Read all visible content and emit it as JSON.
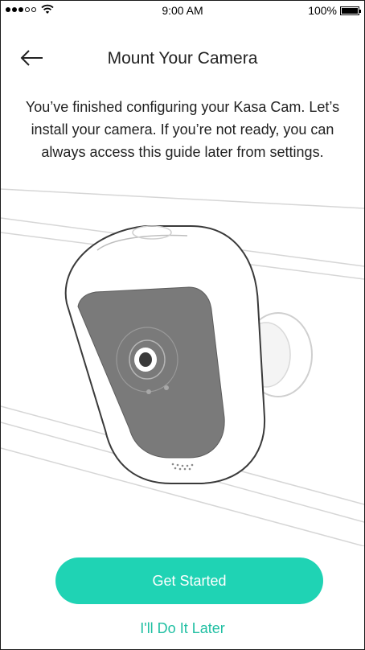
{
  "status_bar": {
    "time": "9:00 AM",
    "battery_text": "100%",
    "battery_level": 1.0,
    "signal_icon": "signal-dots-icon",
    "wifi_icon": "wifi-icon",
    "battery_icon": "battery-icon"
  },
  "header": {
    "title": "Mount Your Camera",
    "back_icon": "back-arrow-icon"
  },
  "intro": {
    "text": "You’ve finished configuring your Kasa Cam. Let’s install your camera. If you’re not ready, you can always access this guide later from settings."
  },
  "illustration": {
    "name": "camera-mount-illustration"
  },
  "actions": {
    "primary_label": "Get Started",
    "secondary_label": "I'll Do It Later"
  },
  "colors": {
    "accent": "#1fd3b4",
    "link": "#1fbfa2",
    "camera_face": "#7a7a7a"
  }
}
